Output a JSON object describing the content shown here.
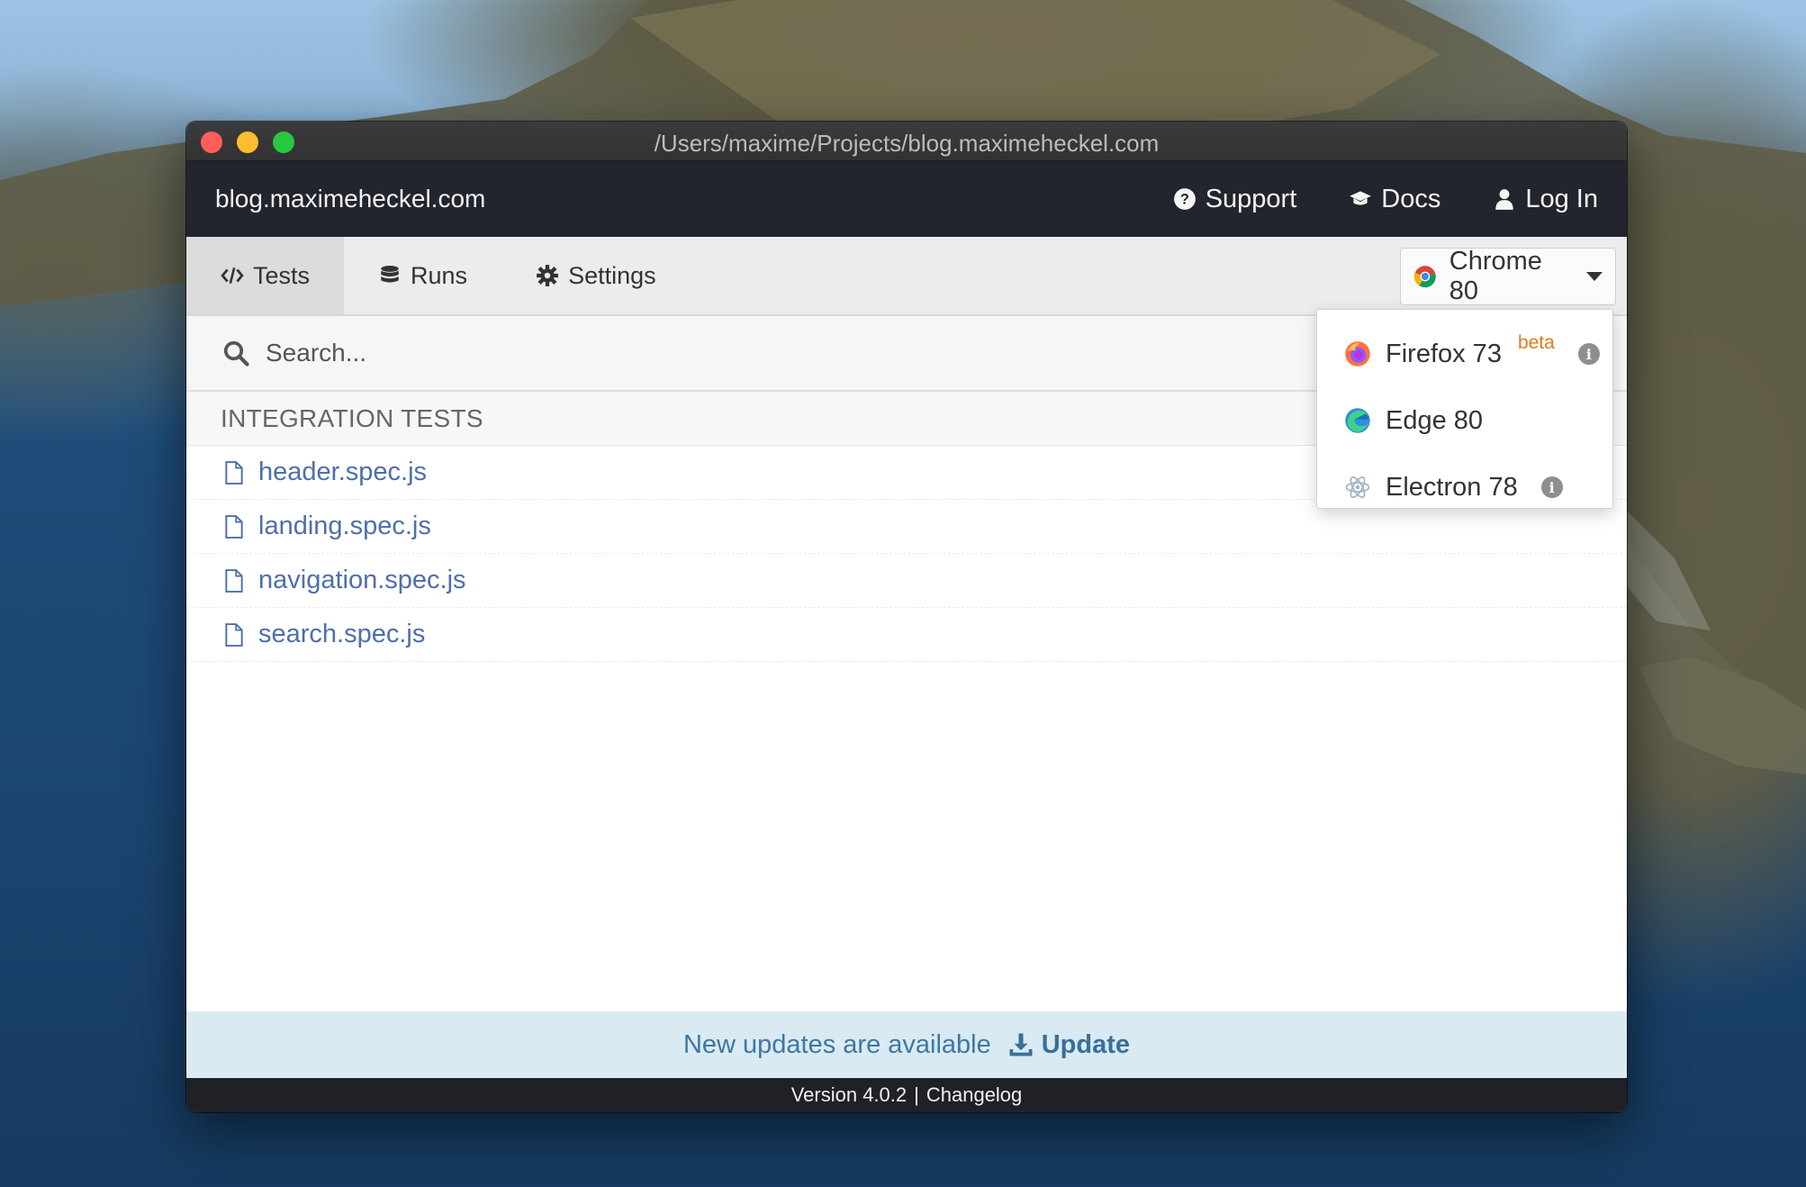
{
  "window": {
    "title": "/Users/maxime/Projects/blog.maximeheckel.com"
  },
  "topnav": {
    "project": "blog.maximeheckel.com",
    "support_label": "Support",
    "docs_label": "Docs",
    "login_label": "Log In"
  },
  "tabs": {
    "tests_label": "Tests",
    "runs_label": "Runs",
    "settings_label": "Settings"
  },
  "browser": {
    "selected": "Chrome 80",
    "options": [
      {
        "label": "Firefox 73",
        "badge": "beta",
        "icon": "firefox-icon",
        "info": "i"
      },
      {
        "label": "Edge 80",
        "icon": "edge-icon"
      },
      {
        "label": "Electron 78",
        "icon": "electron-icon",
        "info": "i"
      }
    ]
  },
  "search": {
    "placeholder": "Search..."
  },
  "specs": {
    "section_title": "INTEGRATION TESTS",
    "files": [
      "header.spec.js",
      "landing.spec.js",
      "navigation.spec.js",
      "search.spec.js"
    ]
  },
  "update": {
    "message": "New updates are available",
    "button_label": "Update"
  },
  "footer": {
    "version": "Version 4.0.2",
    "separator": "|",
    "changelog": "Changelog"
  },
  "colors": {
    "nav_bg": "#22252e",
    "link_blue": "#4f6fa8",
    "beta_orange": "#e07b1a",
    "update_bg": "#d9eaf3"
  }
}
